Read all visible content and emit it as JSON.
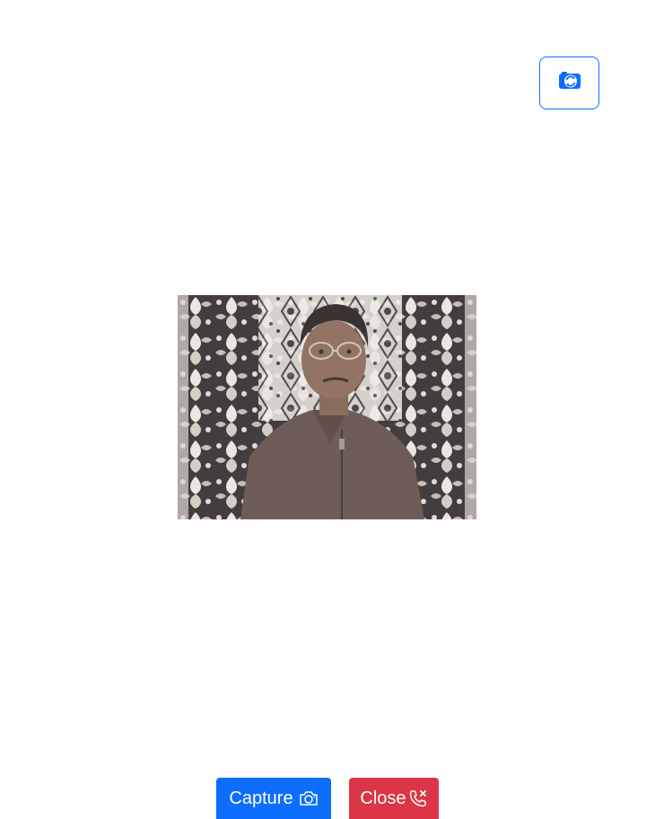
{
  "toolbar": {
    "switch_camera_icon": "camera-switch-icon",
    "accent_color": "#0d6efd"
  },
  "video": {
    "content": "live-webcam-feed"
  },
  "actions": {
    "capture_label": "Capture",
    "capture_icon": "camera-icon",
    "capture_color": "#0d6efd",
    "close_label": "Close",
    "close_icon": "phone-x-icon",
    "close_color": "#dc3545"
  }
}
